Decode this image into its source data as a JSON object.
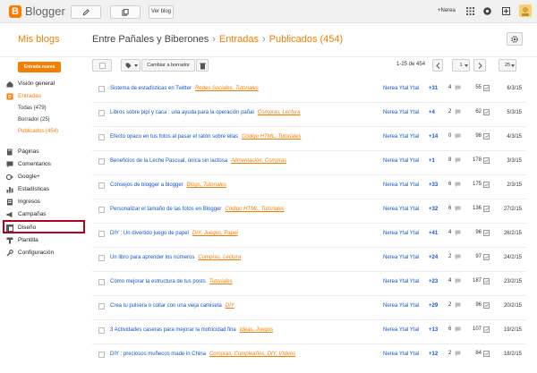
{
  "topbar": {
    "brand": "Blogger",
    "view_blog": "Ver blog",
    "user": "+Nerea"
  },
  "header": {
    "my_blogs": "Mis blogs",
    "blog_name": "Entre Pañales y Biberones",
    "section": "Entradas",
    "subsection": "Publicados (454)"
  },
  "sidebar": {
    "new_post": "Entrada nueva",
    "overview": "Visión general",
    "posts": "Entradas",
    "all": "Todas (479)",
    "draft": "Borrador (25)",
    "published": "Publicados (454)",
    "pages": "Páginas",
    "comments": "Comentarios",
    "google_plus": "Google+",
    "stats": "Estadísticas",
    "earnings": "Ingresos",
    "campaigns": "Campañas",
    "design": "Diseño",
    "template": "Plantilla",
    "settings": "Configuración"
  },
  "toolbar": {
    "revert": "Cambiar a borrador",
    "range": "1-25 de 454",
    "page": "1",
    "per_page": "25"
  },
  "posts": [
    {
      "title": "Sistema de estadísticas en Twitter",
      "labels": "Redes Sociales, Tutoriales",
      "author": "Nerea Ytal Ytal",
      "plus": "+31",
      "comments": "4",
      "views": "55",
      "date": "6/3/15"
    },
    {
      "title": "Libros sobre pipí y caca : una ayuda para la operación pañal",
      "labels": "Compras, Lectura",
      "author": "Nerea Ytal Ytal",
      "plus": "+4",
      "comments": "2",
      "views": "62",
      "date": "5/3/15"
    },
    {
      "title": "Efecto opaco en tus fotos al pasar el ratón sobre ellas",
      "labels": "Código HTML, Tutoriales",
      "author": "Nerea Ytal Ytal",
      "plus": "+14",
      "comments": "0",
      "views": "98",
      "date": "4/3/15"
    },
    {
      "title": "Beneficios de la Leche Pascual, única sin lactosa",
      "labels": "Alimentación, Compras",
      "author": "Nerea Ytal Ytal",
      "plus": "+1",
      "comments": "8",
      "views": "178",
      "date": "3/3/15"
    },
    {
      "title": "Consejos de blogger a blogger",
      "labels": "Blogs, Tutoriales",
      "author": "Nerea Ytal Ytal",
      "plus": "+33",
      "comments": "6",
      "views": "175",
      "date": "2/3/15"
    },
    {
      "title": "Personalizar el tamaño de las fotos en Blogger",
      "labels": "Código HTML, Tutoriales",
      "author": "Nerea Ytal Ytal",
      "plus": "+32",
      "comments": "6",
      "views": "136",
      "date": "27/2/15"
    },
    {
      "title": "DIY : Un divertido juego de papel",
      "labels": "DIY, Juegos, Papel",
      "author": "Nerea Ytal Ytal",
      "plus": "+41",
      "comments": "4",
      "views": "96",
      "date": "26/2/15"
    },
    {
      "title": "Un libro para aprender los números",
      "labels": "Compras, Lectura",
      "author": "Nerea Ytal Ytal",
      "plus": "+24",
      "comments": "2",
      "views": "97",
      "date": "24/2/15"
    },
    {
      "title": "Cómo mejorar la estructura de tus posts",
      "labels": "Tutoriales",
      "author": "Nerea Ytal Ytal",
      "plus": "+23",
      "comments": "4",
      "views": "187",
      "date": "23/2/15"
    },
    {
      "title": "Crea tu pulsera o collar con una vieja camiseta",
      "labels": "DIY",
      "author": "Nerea Ytal Ytal",
      "plus": "+29",
      "comments": "2",
      "views": "96",
      "date": "20/2/15"
    },
    {
      "title": "3 Actividades caseras para mejorar la motricidad fina",
      "labels": "Ideas, Juegos",
      "author": "Nerea Ytal Ytal",
      "plus": "+13",
      "comments": "6",
      "views": "107",
      "date": "19/2/15"
    },
    {
      "title": "DIY : preciosos muñecos made in China",
      "labels": "Compras, Cumpleaños, DIY, Vídeos",
      "author": "Nerea Ytal Ytal",
      "plus": "+12",
      "comments": "2",
      "views": "84",
      "date": "18/2/15"
    }
  ],
  "colors": {
    "accent": "#f57d00",
    "link": "#1155cc",
    "highlight": "#b3001b"
  }
}
